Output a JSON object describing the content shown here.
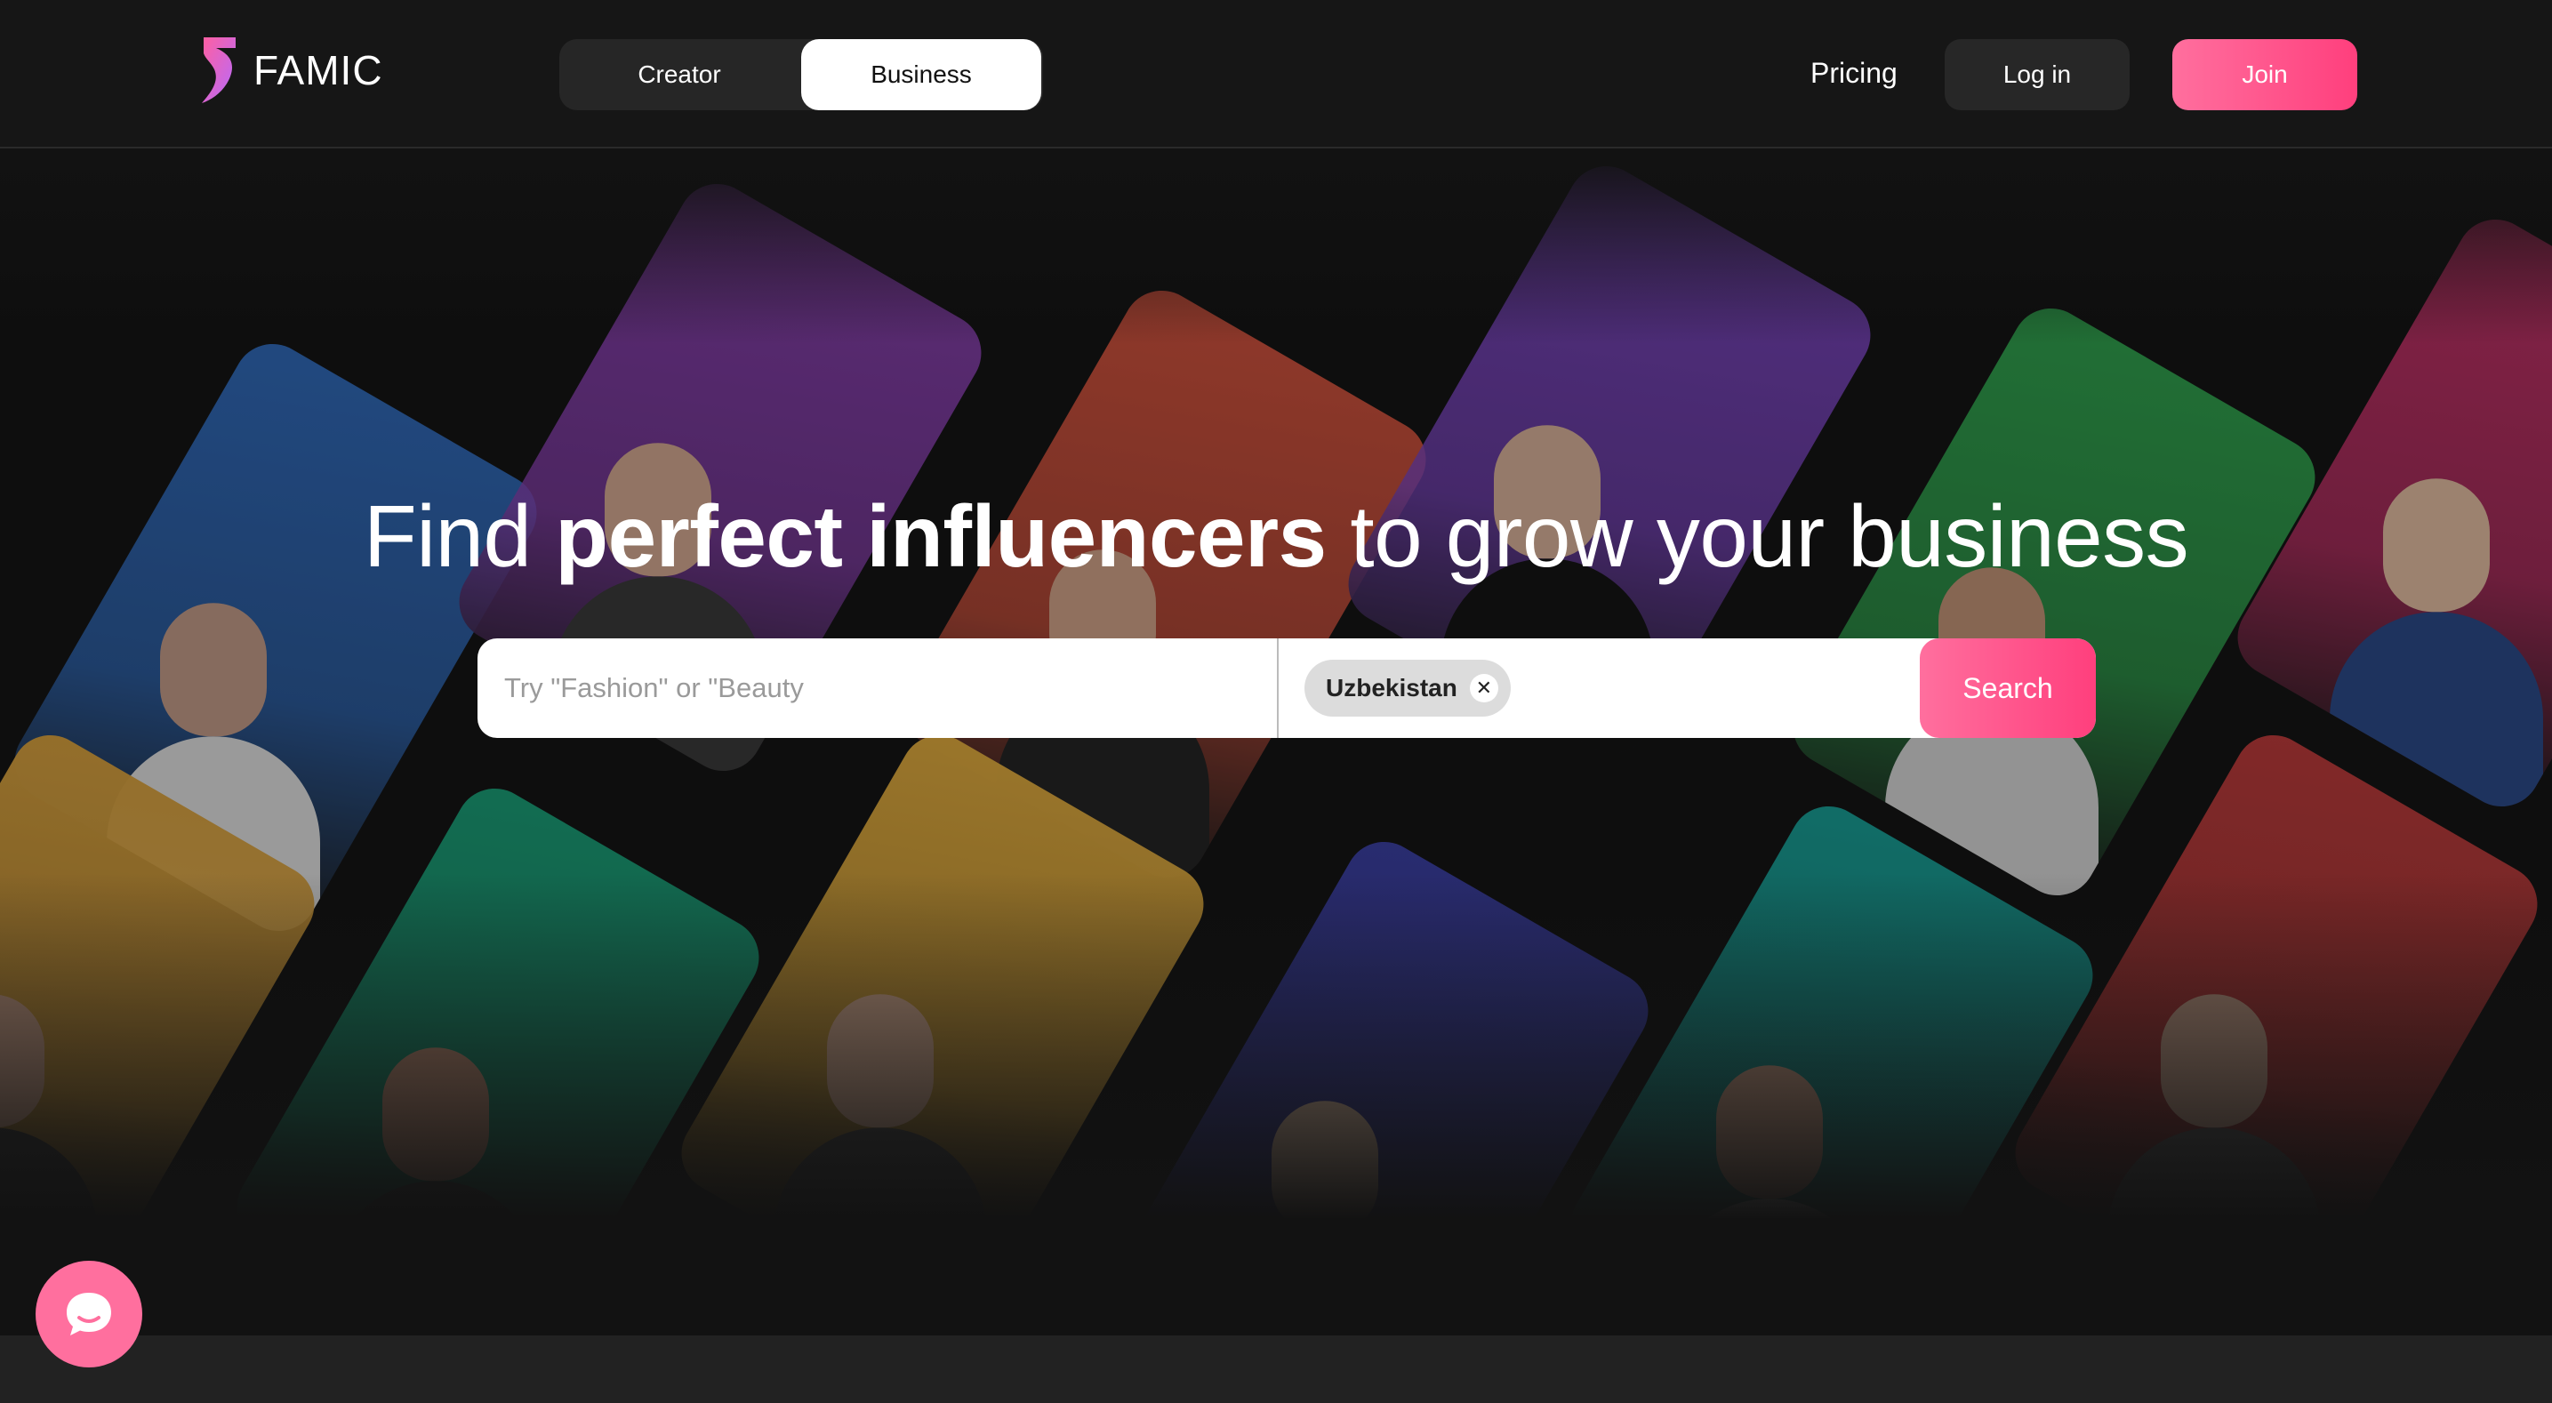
{
  "brand": {
    "name": "FAMIC",
    "accent": "#ff4f87"
  },
  "header": {
    "switch": {
      "creator_label": "Creator",
      "business_label": "Business",
      "active": "Business"
    },
    "pricing_label": "Pricing",
    "login_label": "Log in",
    "join_label": "Join"
  },
  "hero": {
    "headline_pre": "Find ",
    "headline_bold": "perfect influencers",
    "headline_post": " to grow your business",
    "search": {
      "placeholder": "Try \"Fashion\" or \"Beauty",
      "location_chip": "Uzbekistan",
      "button_label": "Search"
    },
    "cards": [
      {
        "bg": "#2f6cc0",
        "skin": "#c9a08d",
        "shirt": "#e9e9e9"
      },
      {
        "bg": "#8a3fb2",
        "skin": "#dcae95",
        "shirt": "#3a3a3a"
      },
      {
        "bg": "#d9533d",
        "skin": "#d9a88d",
        "shirt": "#222222"
      },
      {
        "bg": "#7b44c2",
        "skin": "#e1b79f",
        "shirt": "#111111"
      },
      {
        "bg": "#2fa84f",
        "skin": "#c9987a",
        "shirt": "#dddddd"
      },
      {
        "bg": "#c9306a",
        "skin": "#ecc3a7",
        "shirt": "#2a4a8c"
      },
      {
        "bg": "#18a37a",
        "skin": "#c89479",
        "shirt": "#333333"
      },
      {
        "bg": "#e9b13d",
        "skin": "#e3b699",
        "shirt": "#444444"
      },
      {
        "bg": "#3b3fa8",
        "skin": "#efc9ad",
        "shirt": "#dddddd"
      },
      {
        "bg": "#16a39a",
        "skin": "#d6a68b",
        "shirt": "#e8e8e8"
      },
      {
        "bg": "#c43b3b",
        "skin": "#caa089",
        "shirt": "#555555"
      },
      {
        "bg": "#e0a63d",
        "skin": "#d3a58a",
        "shirt": "#333333"
      }
    ]
  },
  "chat": {
    "icon": "chat-bubble-icon"
  }
}
